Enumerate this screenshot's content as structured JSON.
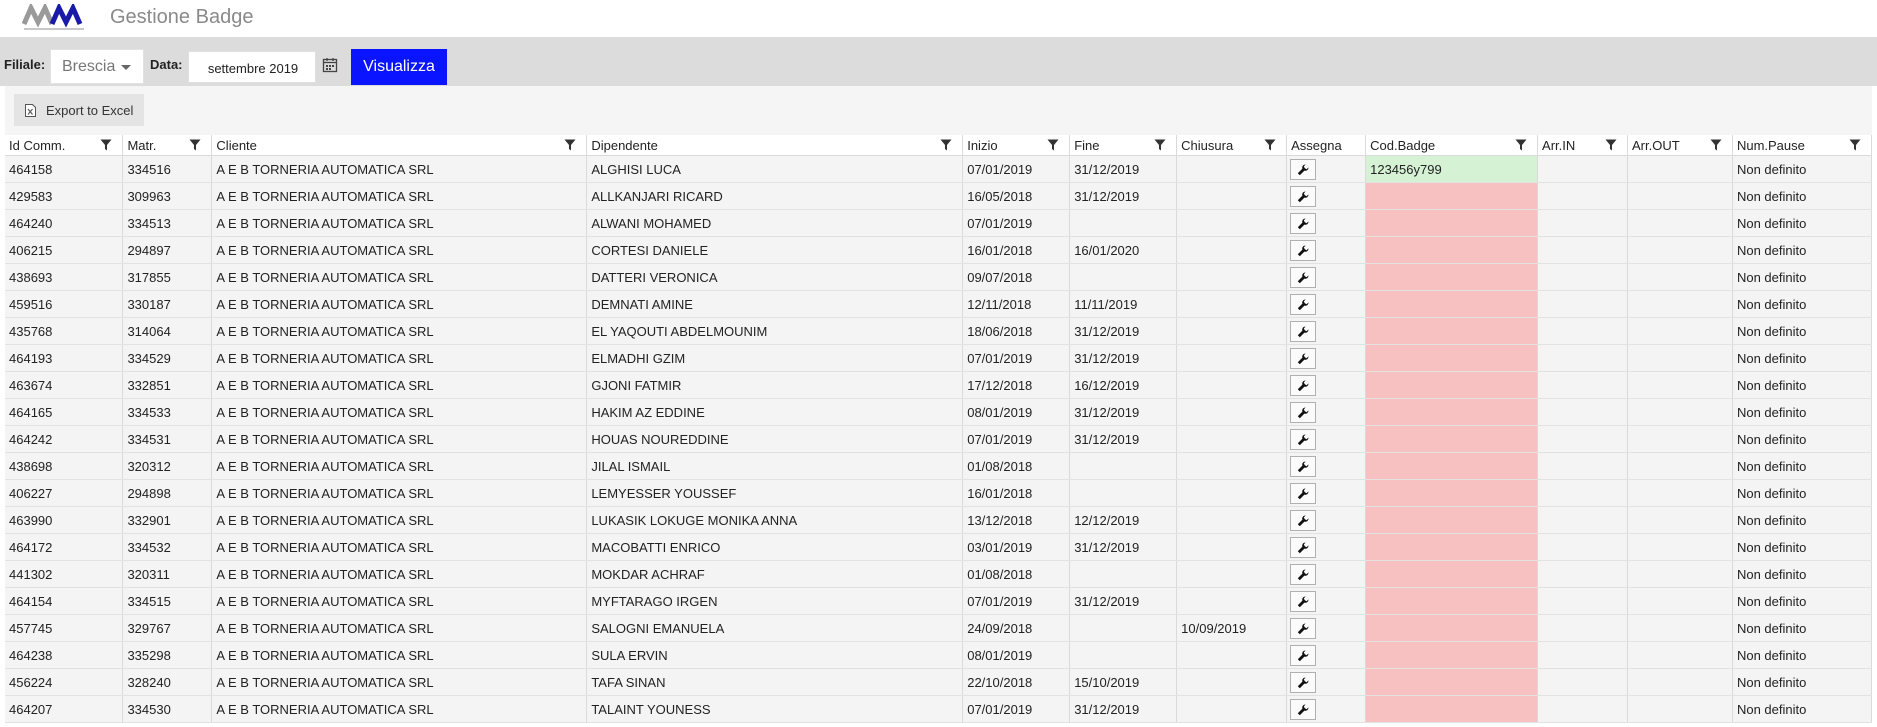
{
  "header": {
    "title": "Gestione Badge",
    "logo_text": "MW"
  },
  "filters": {
    "filiale_label": "Filiale:",
    "filiale_value": "Brescia",
    "data_label": "Data:",
    "data_value": "settembre 2019",
    "visualizza_label": "Visualizza"
  },
  "toolbar": {
    "export_label": "Export to Excel"
  },
  "colors": {
    "accent": "#0a14ff",
    "badge_ok": "#d5f2d5",
    "badge_missing": "#f8c1c1"
  },
  "table": {
    "columns": [
      {
        "key": "id",
        "label": "Id Comm.",
        "filter": true
      },
      {
        "key": "matr",
        "label": "Matr.",
        "filter": true
      },
      {
        "key": "cliente",
        "label": "Cliente",
        "filter": true
      },
      {
        "key": "dip",
        "label": "Dipendente",
        "filter": true
      },
      {
        "key": "inizio",
        "label": "Inizio",
        "filter": true
      },
      {
        "key": "fine",
        "label": "Fine",
        "filter": true
      },
      {
        "key": "chiusura",
        "label": "Chiusura",
        "filter": true
      },
      {
        "key": "assegna",
        "label": "Assegna",
        "filter": false
      },
      {
        "key": "badge",
        "label": "Cod.Badge",
        "filter": true
      },
      {
        "key": "arrin",
        "label": "Arr.IN",
        "filter": true
      },
      {
        "key": "arrout",
        "label": "Arr.OUT",
        "filter": true
      },
      {
        "key": "pause",
        "label": "Num.Pause",
        "filter": true
      }
    ],
    "rows": [
      {
        "id": "464158",
        "matr": "334516",
        "cliente": "A E B TORNERIA AUTOMATICA SRL",
        "dip": "ALGHISI LUCA",
        "inizio": "07/01/2019",
        "fine": "31/12/2019",
        "chiusura": "",
        "badge": "123456y799",
        "arrin": "",
        "arrout": "",
        "pause": "Non definito"
      },
      {
        "id": "429583",
        "matr": "309963",
        "cliente": "A E B TORNERIA AUTOMATICA SRL",
        "dip": "ALLKANJARI RICARD",
        "inizio": "16/05/2018",
        "fine": "31/12/2019",
        "chiusura": "",
        "badge": "",
        "arrin": "",
        "arrout": "",
        "pause": "Non definito"
      },
      {
        "id": "464240",
        "matr": "334513",
        "cliente": "A E B TORNERIA AUTOMATICA SRL",
        "dip": "ALWANI MOHAMED",
        "inizio": "07/01/2019",
        "fine": "",
        "chiusura": "",
        "badge": "",
        "arrin": "",
        "arrout": "",
        "pause": "Non definito"
      },
      {
        "id": "406215",
        "matr": "294897",
        "cliente": "A E B TORNERIA AUTOMATICA SRL",
        "dip": "CORTESI DANIELE",
        "inizio": "16/01/2018",
        "fine": "16/01/2020",
        "chiusura": "",
        "badge": "",
        "arrin": "",
        "arrout": "",
        "pause": "Non definito"
      },
      {
        "id": "438693",
        "matr": "317855",
        "cliente": "A E B TORNERIA AUTOMATICA SRL",
        "dip": "DATTERI VERONICA",
        "inizio": "09/07/2018",
        "fine": "",
        "chiusura": "",
        "badge": "",
        "arrin": "",
        "arrout": "",
        "pause": "Non definito"
      },
      {
        "id": "459516",
        "matr": "330187",
        "cliente": "A E B TORNERIA AUTOMATICA SRL",
        "dip": "DEMNATI AMINE",
        "inizio": "12/11/2018",
        "fine": "11/11/2019",
        "chiusura": "",
        "badge": "",
        "arrin": "",
        "arrout": "",
        "pause": "Non definito"
      },
      {
        "id": "435768",
        "matr": "314064",
        "cliente": "A E B TORNERIA AUTOMATICA SRL",
        "dip": "EL YAQOUTI ABDELMOUNIM",
        "inizio": "18/06/2018",
        "fine": "31/12/2019",
        "chiusura": "",
        "badge": "",
        "arrin": "",
        "arrout": "",
        "pause": "Non definito"
      },
      {
        "id": "464193",
        "matr": "334529",
        "cliente": "A E B TORNERIA AUTOMATICA SRL",
        "dip": "ELMADHI GZIM",
        "inizio": "07/01/2019",
        "fine": "31/12/2019",
        "chiusura": "",
        "badge": "",
        "arrin": "",
        "arrout": "",
        "pause": "Non definito"
      },
      {
        "id": "463674",
        "matr": "332851",
        "cliente": "A E B TORNERIA AUTOMATICA SRL",
        "dip": "GJONI FATMIR",
        "inizio": "17/12/2018",
        "fine": "16/12/2019",
        "chiusura": "",
        "badge": "",
        "arrin": "",
        "arrout": "",
        "pause": "Non definito"
      },
      {
        "id": "464165",
        "matr": "334533",
        "cliente": "A E B TORNERIA AUTOMATICA SRL",
        "dip": "HAKIM AZ EDDINE",
        "inizio": "08/01/2019",
        "fine": "31/12/2019",
        "chiusura": "",
        "badge": "",
        "arrin": "",
        "arrout": "",
        "pause": "Non definito"
      },
      {
        "id": "464242",
        "matr": "334531",
        "cliente": "A E B TORNERIA AUTOMATICA SRL",
        "dip": "HOUAS NOUREDDINE",
        "inizio": "07/01/2019",
        "fine": "31/12/2019",
        "chiusura": "",
        "badge": "",
        "arrin": "",
        "arrout": "",
        "pause": "Non definito"
      },
      {
        "id": "438698",
        "matr": "320312",
        "cliente": "A E B TORNERIA AUTOMATICA SRL",
        "dip": "JILAL ISMAIL",
        "inizio": "01/08/2018",
        "fine": "",
        "chiusura": "",
        "badge": "",
        "arrin": "",
        "arrout": "",
        "pause": "Non definito"
      },
      {
        "id": "406227",
        "matr": "294898",
        "cliente": "A E B TORNERIA AUTOMATICA SRL",
        "dip": "LEMYESSER YOUSSEF",
        "inizio": "16/01/2018",
        "fine": "",
        "chiusura": "",
        "badge": "",
        "arrin": "",
        "arrout": "",
        "pause": "Non definito"
      },
      {
        "id": "463990",
        "matr": "332901",
        "cliente": "A E B TORNERIA AUTOMATICA SRL",
        "dip": "LUKASIK LOKUGE MONIKA ANNA",
        "inizio": "13/12/2018",
        "fine": "12/12/2019",
        "chiusura": "",
        "badge": "",
        "arrin": "",
        "arrout": "",
        "pause": "Non definito"
      },
      {
        "id": "464172",
        "matr": "334532",
        "cliente": "A E B TORNERIA AUTOMATICA SRL",
        "dip": "MACOBATTI ENRICO",
        "inizio": "03/01/2019",
        "fine": "31/12/2019",
        "chiusura": "",
        "badge": "",
        "arrin": "",
        "arrout": "",
        "pause": "Non definito"
      },
      {
        "id": "441302",
        "matr": "320311",
        "cliente": "A E B TORNERIA AUTOMATICA SRL",
        "dip": "MOKDAR ACHRAF",
        "inizio": "01/08/2018",
        "fine": "",
        "chiusura": "",
        "badge": "",
        "arrin": "",
        "arrout": "",
        "pause": "Non definito"
      },
      {
        "id": "464154",
        "matr": "334515",
        "cliente": "A E B TORNERIA AUTOMATICA SRL",
        "dip": "MYFTARAGO IRGEN",
        "inizio": "07/01/2019",
        "fine": "31/12/2019",
        "chiusura": "",
        "badge": "",
        "arrin": "",
        "arrout": "",
        "pause": "Non definito"
      },
      {
        "id": "457745",
        "matr": "329767",
        "cliente": "A E B TORNERIA AUTOMATICA SRL",
        "dip": "SALOGNI EMANUELA",
        "inizio": "24/09/2018",
        "fine": "",
        "chiusura": "10/09/2019",
        "badge": "",
        "arrin": "",
        "arrout": "",
        "pause": "Non definito"
      },
      {
        "id": "464238",
        "matr": "335298",
        "cliente": "A E B TORNERIA AUTOMATICA SRL",
        "dip": "SULA ERVIN",
        "inizio": "08/01/2019",
        "fine": "",
        "chiusura": "",
        "badge": "",
        "arrin": "",
        "arrout": "",
        "pause": "Non definito"
      },
      {
        "id": "456224",
        "matr": "328240",
        "cliente": "A E B TORNERIA AUTOMATICA SRL",
        "dip": "TAFA SINAN",
        "inizio": "22/10/2018",
        "fine": "15/10/2019",
        "chiusura": "",
        "badge": "",
        "arrin": "",
        "arrout": "",
        "pause": "Non definito"
      },
      {
        "id": "464207",
        "matr": "334530",
        "cliente": "A E B TORNERIA AUTOMATICA SRL",
        "dip": "TALAINT YOUNESS",
        "inizio": "07/01/2019",
        "fine": "31/12/2019",
        "chiusura": "",
        "badge": "",
        "arrin": "",
        "arrout": "",
        "pause": "Non definito"
      }
    ]
  }
}
